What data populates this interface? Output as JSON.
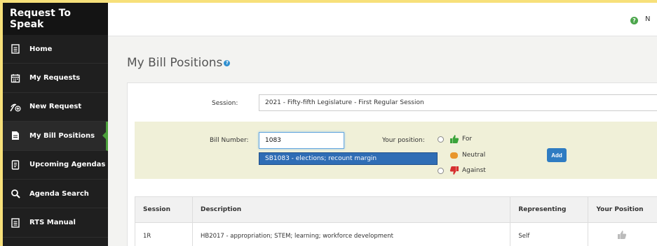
{
  "app": {
    "title": "Request To Speak"
  },
  "sidebar": {
    "items": [
      {
        "label": "Home",
        "icon": "home-document-icon"
      },
      {
        "label": "My Requests",
        "icon": "calendar-icon"
      },
      {
        "label": "New Request",
        "icon": "new-request-icon"
      },
      {
        "label": "My Bill Positions",
        "icon": "document-icon",
        "active": true
      },
      {
        "label": "Upcoming Agendas",
        "icon": "agenda-icon"
      },
      {
        "label": "Agenda Search",
        "icon": "search-icon"
      },
      {
        "label": "RTS Manual",
        "icon": "manual-icon"
      }
    ]
  },
  "topbar": {
    "help_glyph": "?",
    "user_initial": "N"
  },
  "page": {
    "title": "My Bill Positions",
    "info_glyph": "?"
  },
  "form": {
    "session_label": "Session:",
    "session_value": "2021 - Fifty-fifth Legislature - First Regular Session",
    "bill_label": "Bill Number:",
    "bill_value": "1083",
    "autocomplete_suggestion": "SB1083 - elections; recount margin",
    "position_label": "Your position:",
    "positions": [
      {
        "label": "For",
        "color": "#3aa33a"
      },
      {
        "label": "Neutral",
        "color": "#e8962c"
      },
      {
        "label": "Against",
        "color": "#d63030"
      }
    ],
    "add_label": "Add"
  },
  "table": {
    "headers": [
      "Session",
      "Description",
      "Representing",
      "Your Position"
    ],
    "rows": [
      {
        "session": "1R",
        "description": "HB2017 - appropriation; STEM; learning; workforce development",
        "representing": "Self",
        "position_icon": "thumbs-up-icon"
      }
    ]
  },
  "colors": {
    "accent_green": "#4a9f3a",
    "primary_blue": "#2f7cc2",
    "sidebar_bg": "#1f1f1f",
    "highlight_yellow": "#f7e07a"
  }
}
